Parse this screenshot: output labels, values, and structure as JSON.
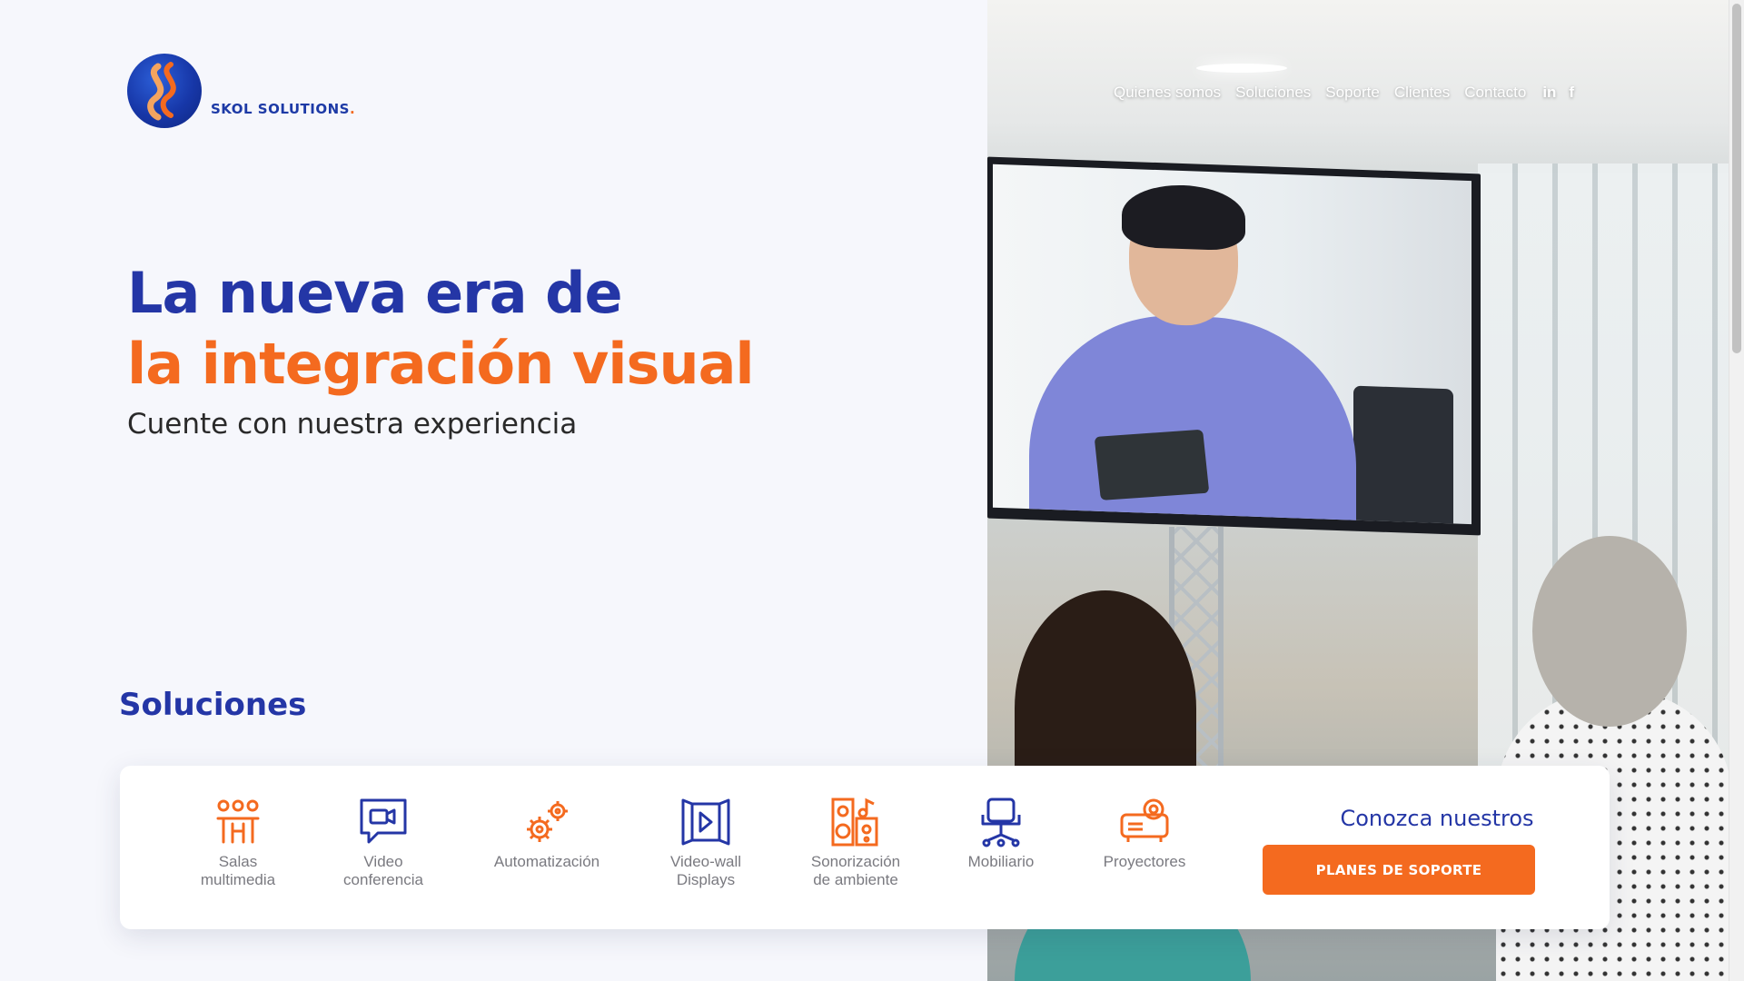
{
  "brand": {
    "name": "SKOL SOLUTIONS",
    "dot": "."
  },
  "nav": {
    "items": [
      "Quienes somos",
      "Soluciones",
      "Soporte",
      "Clientes",
      "Contacto"
    ],
    "social": [
      "in",
      "f"
    ]
  },
  "hero": {
    "line1": "La nueva era de",
    "line2": "la integración visual",
    "subtitle": "Cuente con nuestra experiencia"
  },
  "solutions": {
    "heading": "Soluciones",
    "items": [
      {
        "label": "Salas\nmultimedia",
        "icon": "meeting-room-icon",
        "color": "#f46a1f"
      },
      {
        "label": "Video\nconferencia",
        "icon": "video-chat-icon",
        "color": "#2436a6"
      },
      {
        "label": "Automatización",
        "icon": "gears-icon",
        "color": "#f46a1f"
      },
      {
        "label": "Video-wall\nDisplays",
        "icon": "video-wall-icon",
        "color": "#2436a6"
      },
      {
        "label": "Sonorización\nde ambiente",
        "icon": "speaker-icon",
        "color": "#f46a1f"
      },
      {
        "label": "Mobiliario",
        "icon": "office-chair-icon",
        "color": "#2436a6"
      },
      {
        "label": "Proyectores",
        "icon": "projector-icon",
        "color": "#f46a1f"
      }
    ],
    "cta": {
      "heading": "Conozca nuestros",
      "button": "PLANES DE SOPORTE"
    }
  },
  "colors": {
    "brand_blue": "#2436a6",
    "brand_orange": "#f46a1f",
    "background": "#f6f7fc"
  }
}
